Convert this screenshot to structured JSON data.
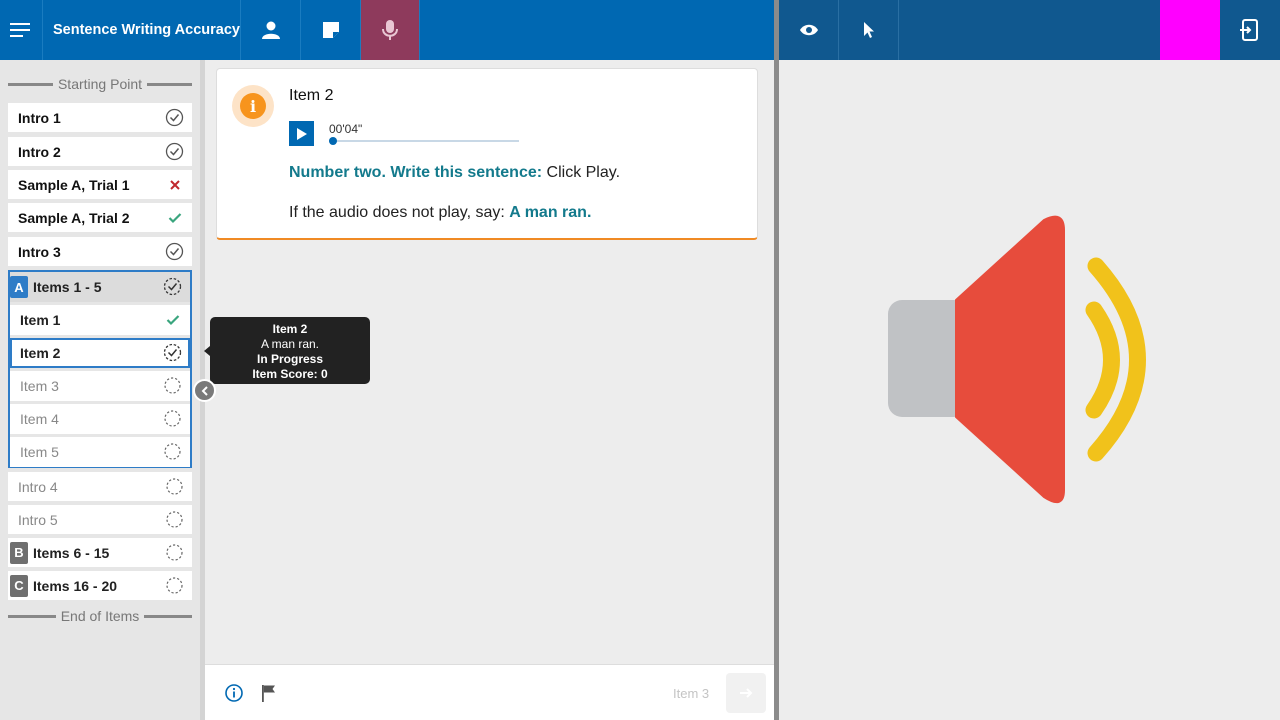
{
  "app": {
    "title": "Sentence Writing Accuracy"
  },
  "toolbar": {
    "tools": [
      "menu-icon",
      "person-icon",
      "note-icon",
      "microphone-icon"
    ],
    "right_tools": [
      "eye-icon",
      "pointer-icon",
      "exit-screen-icon"
    ],
    "colors": {
      "primary": "#0068b2",
      "active_tool": "#8e3a5c",
      "secondary_bar": "#10588f",
      "highlight": "#ff00ff"
    }
  },
  "sidebar": {
    "start_label": "Starting Point",
    "end_label": "End of Items",
    "items": [
      {
        "label": "Intro 1",
        "status": "complete"
      },
      {
        "label": "Intro 2",
        "status": "complete"
      },
      {
        "label": "Sample A, Trial 1",
        "status": "incorrect"
      },
      {
        "label": "Sample A, Trial 2",
        "status": "correct"
      },
      {
        "label": "Intro 3",
        "status": "complete"
      }
    ],
    "group_a": {
      "badge": "A",
      "label": "Items 1 - 5",
      "items": [
        {
          "label": "Item 1",
          "status": "correct"
        },
        {
          "label": "Item 2",
          "status": "in-progress"
        },
        {
          "label": "Item 3",
          "status": "pending"
        },
        {
          "label": "Item 4",
          "status": "pending"
        },
        {
          "label": "Item 5",
          "status": "pending"
        }
      ]
    },
    "after_items": [
      {
        "label": "Intro 4",
        "status": "pending"
      },
      {
        "label": "Intro 5",
        "status": "pending"
      }
    ],
    "groups": [
      {
        "badge": "B",
        "label": "Items 6 - 15",
        "status": "pending"
      },
      {
        "badge": "C",
        "label": "Items 16 - 20",
        "status": "pending"
      }
    ]
  },
  "tooltip": {
    "title": "Item 2",
    "answer": "A man ran.",
    "status": "In Progress",
    "score": "Item Score: 0"
  },
  "card": {
    "title": "Item 2",
    "audio_time": "00'04\"",
    "audio_progress": 0.0,
    "instruction_bold": "Number two. Write this sentence:",
    "instruction_rest": " Click Play.",
    "fallback_prefix": "If the audio does not play, say: ",
    "fallback_bold": "A man ran."
  },
  "footer": {
    "next_label": "Item 3"
  }
}
